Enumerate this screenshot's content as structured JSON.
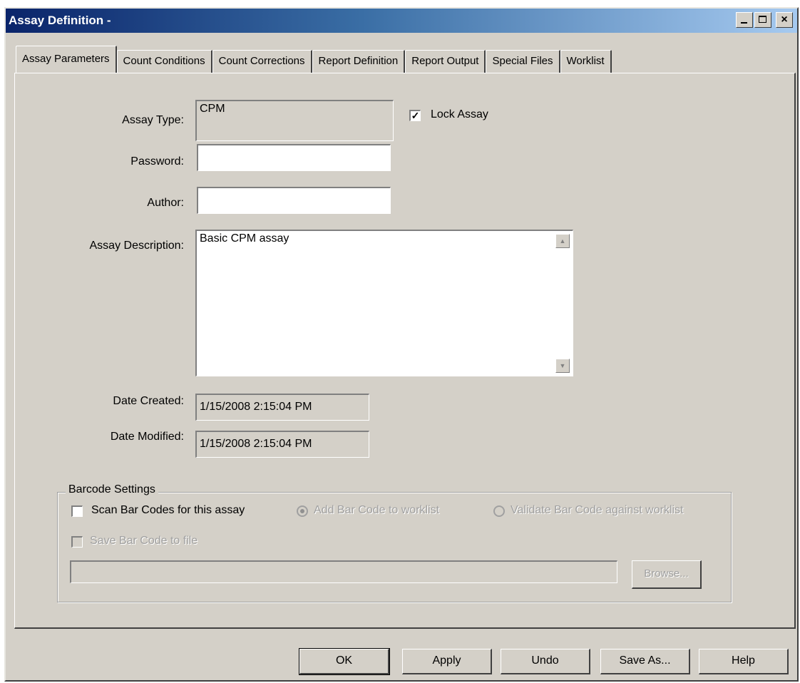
{
  "window": {
    "title": "Assay Definition -"
  },
  "tabs": [
    {
      "label": "Assay Parameters"
    },
    {
      "label": "Count Conditions"
    },
    {
      "label": "Count Corrections"
    },
    {
      "label": "Report Definition"
    },
    {
      "label": "Report Output"
    },
    {
      "label": "Special Files"
    },
    {
      "label": "Worklist"
    }
  ],
  "form": {
    "assay_type_label": "Assay Type:",
    "assay_type_value": "CPM",
    "lock_assay_label": "Lock Assay",
    "lock_assay_checked": true,
    "password_label": "Password:",
    "password_value": "",
    "author_label": "Author:",
    "author_value": "",
    "description_label": "Assay Description:",
    "description_value": "Basic CPM assay",
    "date_created_label": "Date Created:",
    "date_created_value": "1/15/2008 2:15:04 PM",
    "date_modified_label": "Date Modified:",
    "date_modified_value": "1/15/2008 2:15:04 PM"
  },
  "barcode": {
    "group_title": "Barcode Settings",
    "scan_label": "Scan Bar Codes for this assay",
    "scan_checked": false,
    "add_label": "Add Bar Code to worklist",
    "add_selected": true,
    "validate_label": "Validate Bar Code against worklist",
    "validate_selected": false,
    "save_label": "Save Bar Code to file",
    "save_checked": false,
    "file_path": "",
    "browse_label": "Browse..."
  },
  "buttons": {
    "ok": "OK",
    "apply": "Apply",
    "undo": "Undo",
    "save_as": "Save As...",
    "help": "Help"
  },
  "icons": {
    "minimize": "minimize-icon",
    "maximize": "maximize-icon",
    "close": "close-icon",
    "checkmark": "checkmark-icon",
    "scroll_up": "arrow-up-icon",
    "scroll_down": "arrow-down-icon"
  }
}
